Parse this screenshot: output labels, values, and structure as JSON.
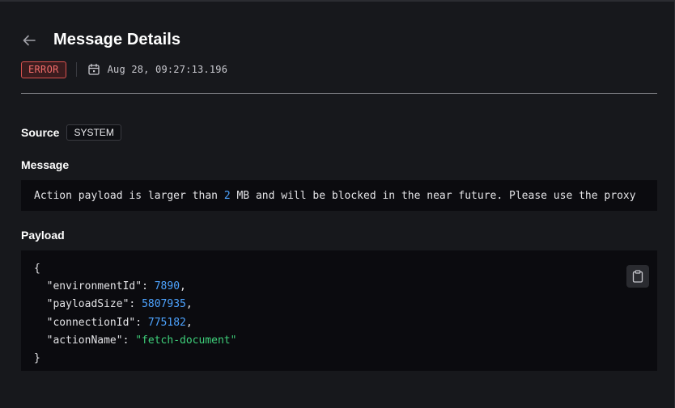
{
  "header": {
    "title": "Message Details"
  },
  "meta": {
    "level": "ERROR",
    "timestamp": "Aug 28, 09:27:13.196"
  },
  "source": {
    "label": "Source",
    "value": "SYSTEM"
  },
  "message": {
    "label": "Message",
    "text_before": "Action payload is larger than ",
    "number": "2",
    "text_after": " MB and will be blocked in the near future. Please use the proxy"
  },
  "payload": {
    "label": "Payload",
    "open_brace": "{",
    "close_brace": "}",
    "entries": [
      {
        "key": "\"environmentId\"",
        "value": "7890",
        "type": "number"
      },
      {
        "key": "\"payloadSize\"",
        "value": "5807935",
        "type": "number"
      },
      {
        "key": "\"connectionId\"",
        "value": "775182",
        "type": "number"
      },
      {
        "key": "\"actionName\"",
        "value": "\"fetch-document\"",
        "type": "string"
      }
    ]
  },
  "icons": {
    "back": "arrow-left-icon",
    "calendar": "calendar-icon",
    "copy": "clipboard-icon"
  },
  "colors": {
    "error": "#f06c6a",
    "number": "#4da3ff",
    "string": "#3ecf7a",
    "code_bg": "#0b0b0f"
  }
}
